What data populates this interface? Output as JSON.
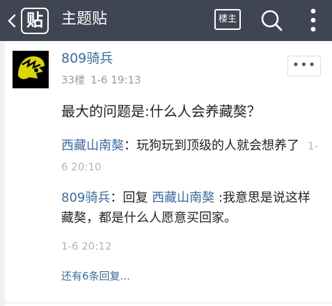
{
  "topbar": {
    "logo_text": "贴",
    "title": "主题贴",
    "lz_label": "楼主",
    "bg_color": "#3f4552"
  },
  "post": {
    "author": "809骑兵",
    "floor": "33楼",
    "time": "1-6 19:13",
    "menu_label": "•••",
    "body": "最大的问题是:什么人会养藏獒？"
  },
  "replies": [
    {
      "user": "西藏山南獒",
      "sep": "：",
      "text": "玩狗玩到顶级的人就会想养了",
      "time": "1-6 20:10"
    },
    {
      "user": "809骑兵",
      "sep": "：",
      "prefix": "回复",
      "reply_to": "西藏山南獒",
      "text": ":我意思是说这样藏獒，都是什么人愿意买回家。",
      "time": "1-6 20:12"
    }
  ],
  "more_replies": "还有6条回复...",
  "colors": {
    "link": "#3a6aa0",
    "meta": "#9a9a9a"
  },
  "icons": {
    "back": "chevron-left-icon",
    "search": "search-icon",
    "more": "more-vertical-icon",
    "avatar": "helmet-avatar"
  }
}
